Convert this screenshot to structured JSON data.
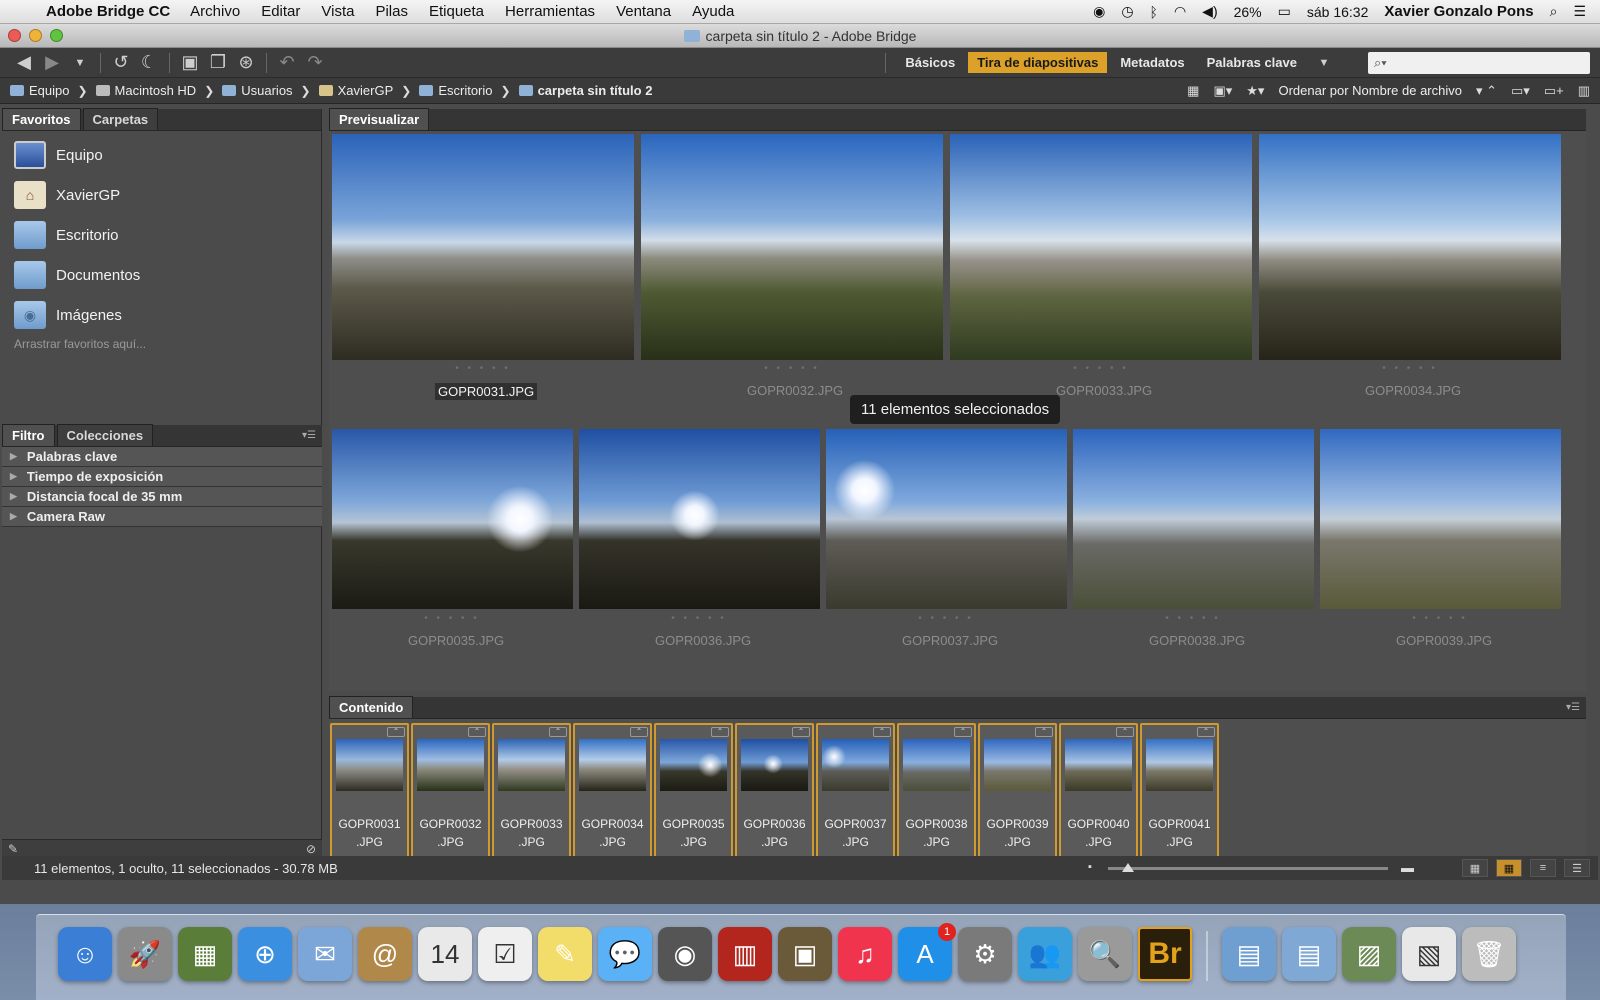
{
  "menubar": {
    "app_name": "Adobe Bridge CC",
    "menus": [
      "Archivo",
      "Editar",
      "Vista",
      "Pilas",
      "Etiqueta",
      "Herramientas",
      "Ventana",
      "Ayuda"
    ],
    "battery": "26%",
    "clock": "sáb 16:32",
    "user": "Xavier Gonzalo Pons"
  },
  "window": {
    "title": "carpeta sin título 2 - Adobe Bridge"
  },
  "toolbar": {
    "workspaces": [
      "Básicos",
      "Tira de diapositivas",
      "Metadatos",
      "Palabras clave"
    ],
    "active_workspace": "Tira de diapositivas",
    "search_placeholder": ""
  },
  "pathbar": {
    "crumbs": [
      "Equipo",
      "Macintosh HD",
      "Usuarios",
      "XavierGP",
      "Escritorio",
      "carpeta sin título 2"
    ],
    "sort_label": "Ordenar por Nombre de archivo"
  },
  "left_panel": {
    "tabs": [
      "Favoritos",
      "Carpetas"
    ],
    "favorites": [
      {
        "label": "Equipo",
        "icon": "computer-icon"
      },
      {
        "label": "XavierGP",
        "icon": "home-icon"
      },
      {
        "label": "Escritorio",
        "icon": "folder-icon"
      },
      {
        "label": "Documentos",
        "icon": "folder-icon"
      },
      {
        "label": "Imágenes",
        "icon": "folder-icon"
      }
    ],
    "favorites_hint": "Arrastrar favoritos aquí...",
    "filter_tabs": [
      "Filtro",
      "Colecciones"
    ],
    "filter_items": [
      "Palabras clave",
      "Tiempo de exposición",
      "Distancia focal de 35 mm",
      "Camera Raw"
    ]
  },
  "preview": {
    "tab": "Previsualizar",
    "selection_message": "11 elementos seleccionados",
    "items": [
      "GOPR0031.JPG",
      "GOPR0032.JPG",
      "GOPR0033.JPG",
      "GOPR0034.JPG",
      "GOPR0035.JPG",
      "GOPR0036.JPG",
      "GOPR0037.JPG",
      "GOPR0038.JPG",
      "GOPR0039.JPG"
    ],
    "primary_selected": "GOPR0031.JPG",
    "rating_dots": "• • • • •"
  },
  "content": {
    "tab": "Contenido",
    "items": [
      {
        "line1": "GOPR0031",
        "line2": ".JPG"
      },
      {
        "line1": "GOPR0032",
        "line2": ".JPG"
      },
      {
        "line1": "GOPR0033",
        "line2": ".JPG"
      },
      {
        "line1": "GOPR0034",
        "line2": ".JPG"
      },
      {
        "line1": "GOPR0035",
        "line2": ".JPG"
      },
      {
        "line1": "GOPR0036",
        "line2": ".JPG"
      },
      {
        "line1": "GOPR0037",
        "line2": ".JPG"
      },
      {
        "line1": "GOPR0038",
        "line2": ".JPG"
      },
      {
        "line1": "GOPR0039",
        "line2": ".JPG"
      },
      {
        "line1": "GOPR0040",
        "line2": ".JPG"
      },
      {
        "line1": "GOPR0041",
        "line2": ".JPG"
      }
    ]
  },
  "status": {
    "text": "11 elementos, 1 oculto, 11 seleccionados - 30.78 MB"
  },
  "dock": {
    "items": [
      {
        "icon": "finder-icon",
        "glyph": "☺",
        "color": "#3a7fd5"
      },
      {
        "icon": "launchpad-icon",
        "glyph": "🚀",
        "color": "#8a8a8a"
      },
      {
        "icon": "photo-browser-icon",
        "glyph": "▦",
        "color": "#5a7d3a"
      },
      {
        "icon": "safari-icon",
        "glyph": "⊕",
        "color": "#3b8fe0"
      },
      {
        "icon": "mail-icon",
        "glyph": "✉",
        "color": "#7da6d8"
      },
      {
        "icon": "contacts-icon",
        "glyph": "@",
        "color": "#b0894a"
      },
      {
        "icon": "calendar-icon",
        "glyph": "14",
        "color": "#e9e9e9"
      },
      {
        "icon": "reminders-icon",
        "glyph": "☑",
        "color": "#efefef"
      },
      {
        "icon": "notes-icon",
        "glyph": "✎",
        "color": "#f2dc6a"
      },
      {
        "icon": "messages-icon",
        "glyph": "💬",
        "color": "#5ab1f5"
      },
      {
        "icon": "facetime-icon",
        "glyph": "◉",
        "color": "#555"
      },
      {
        "icon": "photo-booth-icon",
        "glyph": "▥",
        "color": "#b3261e"
      },
      {
        "icon": "iphoto-icon",
        "glyph": "▣",
        "color": "#6b5a3a"
      },
      {
        "icon": "itunes-icon",
        "glyph": "♫",
        "color": "#f0344d"
      },
      {
        "icon": "app-store-icon",
        "glyph": "A",
        "color": "#1f8fe8",
        "badge": "1"
      },
      {
        "icon": "system-preferences-icon",
        "glyph": "⚙",
        "color": "#7a7a7a"
      },
      {
        "icon": "messenger-icon",
        "glyph": "👥",
        "color": "#3aa0dc"
      },
      {
        "icon": "preview-icon",
        "glyph": "🔍",
        "color": "#9a9a9a"
      },
      {
        "icon": "adobe-bridge-icon",
        "glyph": "Br",
        "color": "#2a1f0a"
      }
    ],
    "stack_items": [
      {
        "icon": "applications-folder-icon",
        "glyph": "▤",
        "color": "#6f9fd0"
      },
      {
        "icon": "documents-folder-icon",
        "glyph": "▤",
        "color": "#7fa8d4"
      },
      {
        "icon": "image-stack-icon",
        "glyph": "▨",
        "color": "#6c8a56"
      },
      {
        "icon": "downloads-stack-icon",
        "glyph": "▧",
        "color": "#e8e8e8"
      },
      {
        "icon": "trash-icon",
        "glyph": "🗑",
        "color": "#bcbcbc"
      }
    ]
  }
}
